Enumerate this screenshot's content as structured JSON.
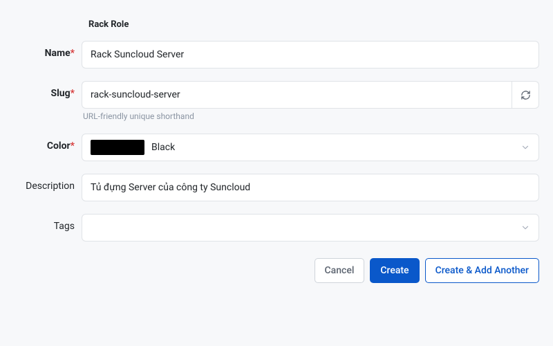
{
  "section_title": "Rack Role",
  "labels": {
    "name": "Name",
    "slug": "Slug",
    "color": "Color",
    "description": "Description",
    "tags": "Tags"
  },
  "fields": {
    "name": {
      "value": "Rack Suncloud Server",
      "required": true
    },
    "slug": {
      "value": "rack-suncloud-server",
      "required": true,
      "help": "URL-friendly unique shorthand"
    },
    "color": {
      "label": "Black",
      "hex": "#000000",
      "required": true
    },
    "description": {
      "value": "Tủ đựng Server của công ty Suncloud"
    },
    "tags": {
      "value": ""
    }
  },
  "buttons": {
    "cancel": "Cancel",
    "create": "Create",
    "create_add": "Create & Add Another"
  }
}
